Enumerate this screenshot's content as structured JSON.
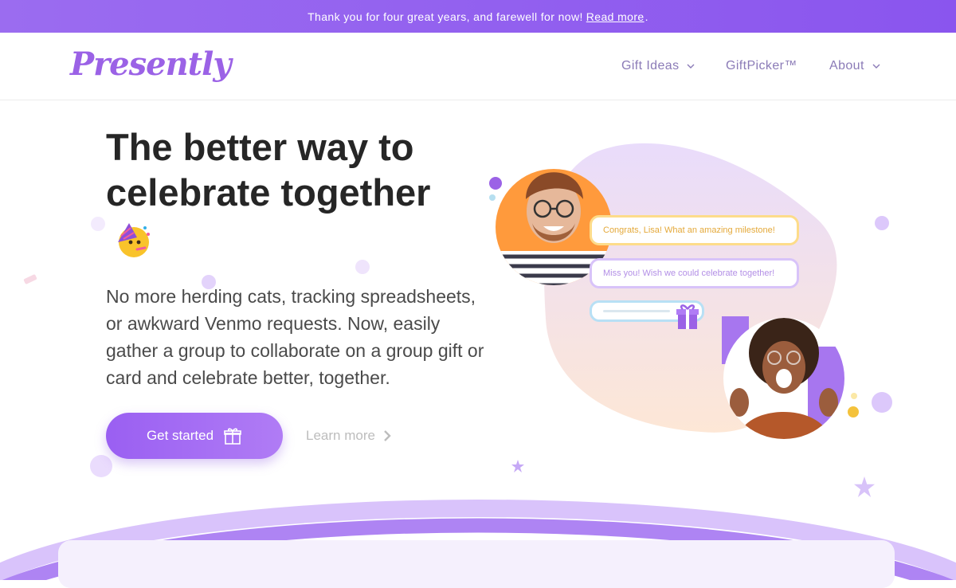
{
  "banner": {
    "text": "Thank you for four great years, and farewell for now!",
    "link": "Read more",
    "suffix": "."
  },
  "header": {
    "logo": "Presently",
    "nav": [
      {
        "label": "Gift Ideas",
        "has_dropdown": true
      },
      {
        "label": "GiftPicker™",
        "has_dropdown": false
      },
      {
        "label": "About",
        "has_dropdown": true
      }
    ]
  },
  "hero": {
    "title": "The better way to celebrate together",
    "emoji": "party-face",
    "description": "No more herding cats, tracking spreadsheets, or awkward Venmo requests. Now, easily gather a group to collaborate on a group gift or card and celebrate better, together.",
    "cta_primary": "Get started",
    "cta_secondary": "Learn more"
  },
  "illustration": {
    "message_1": "Congrats, Lisa! What an amazing milestone!",
    "message_2": "Miss you! Wish we could celebrate together!"
  },
  "colors": {
    "brand": "#9b62e6",
    "banner": "#8a55ee",
    "title": "#262626",
    "accent_orange": "#ff9a3c"
  }
}
